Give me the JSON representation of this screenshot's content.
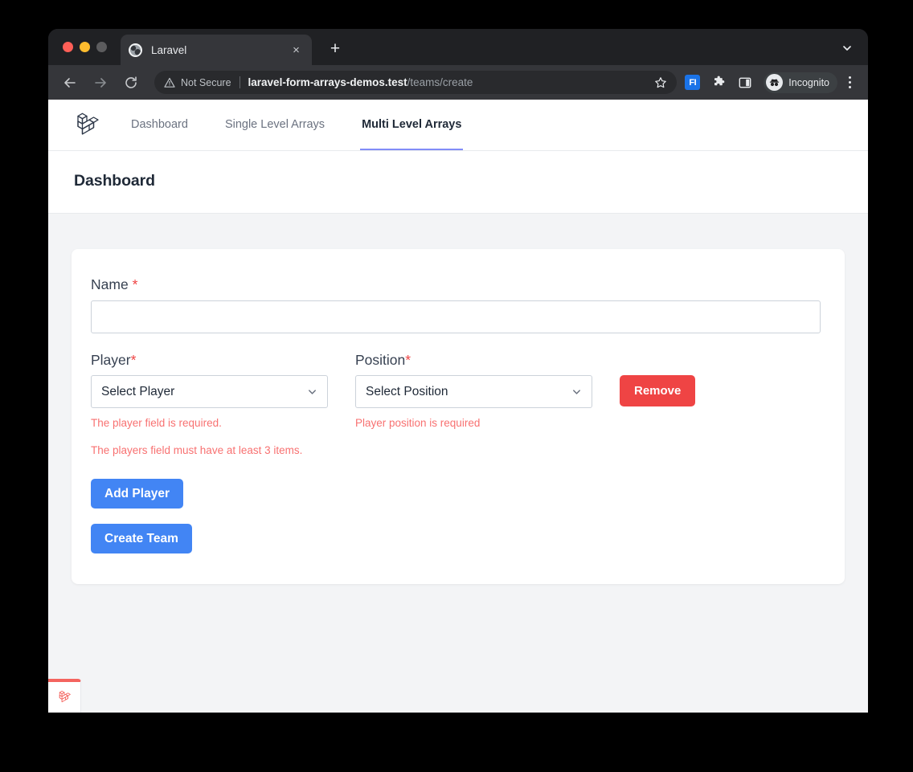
{
  "browser": {
    "tab": {
      "title": "Laravel",
      "favicon": "globe-icon",
      "close": "×"
    },
    "new_tab_label": "+",
    "tab_search_icon": "chevron-down-icon",
    "nav": {
      "back": "back-icon",
      "forward": "forward-icon",
      "reload": "reload-icon"
    },
    "omnibox": {
      "security_label": "Not Secure",
      "security_icon": "warning-triangle-icon",
      "url_domain": "laravel-form-arrays-demos.test",
      "url_path": "/teams/create",
      "bookmark_icon": "star-icon"
    },
    "toolbar_right": {
      "extension_badge": "FI",
      "puzzle_icon": "extensions-puzzle-icon",
      "sidepanel_icon": "side-panel-icon",
      "incognito_label": "Incognito",
      "incognito_icon": "incognito-spy-icon",
      "menu_icon": "kebab-menu-icon"
    },
    "traffic_lights": [
      "close",
      "minimize",
      "maximize"
    ]
  },
  "app": {
    "brand_icon": "laravel-logo",
    "nav_items": [
      {
        "label": "Dashboard",
        "active": false
      },
      {
        "label": "Single Level Arrays",
        "active": false
      },
      {
        "label": "Multi Level Arrays",
        "active": true
      }
    ],
    "page_title": "Dashboard"
  },
  "form": {
    "name": {
      "label": "Name",
      "required_marker": "*",
      "value": "",
      "placeholder": ""
    },
    "player": {
      "label": "Player",
      "required_marker": "*",
      "selected": "Select Player",
      "error": "The player field is required."
    },
    "position": {
      "label": "Position",
      "required_marker": "*",
      "selected": "Select Position",
      "error": "Player position is required"
    },
    "remove_button": "Remove",
    "players_error": "The players field must have at least 3 items.",
    "add_player_button": "Add Player",
    "create_team_button": "Create Team"
  },
  "debugbar": {
    "icon": "laravel-debugbar-logo"
  },
  "colors": {
    "accent_blue": "#4285f4",
    "danger_red": "#ef4444",
    "error_text": "#f87171",
    "nav_active_underline": "#818cf8",
    "page_bg": "#f3f4f6",
    "browser_chrome": "#202124"
  }
}
